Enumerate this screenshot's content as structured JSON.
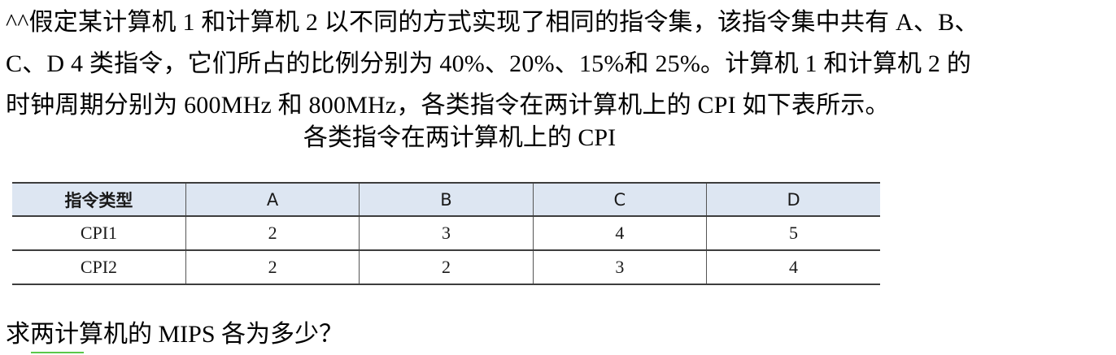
{
  "problem": {
    "lines": [
      "^^假定某计算机 1 和计算机 2 以不同的方式实现了相同的指令集，该指令集中共有 A、B、",
      "C、D 4 类指令，它们所占的比例分别为 40%、20%、15%和 25%。计算机 1 和计算机 2 的",
      "时钟周期分别为 600MHz 和 800MHz，各类指令在两计算机上的 CPI 如下表所示。"
    ],
    "caption": "各类指令在两计算机上的 CPI",
    "question": "求两计算机的 MIPS 各为多少？"
  },
  "table": {
    "headers": [
      "指令类型",
      "A",
      "B",
      "C",
      "D"
    ],
    "rows": [
      [
        "CPI1",
        "2",
        "3",
        "4",
        "5"
      ],
      [
        "CPI2",
        "2",
        "2",
        "3",
        "4"
      ]
    ]
  },
  "colors": {
    "header_bg": "#dde6f2",
    "rule": "#3d3d3d",
    "underline_mark": "#5bc84a"
  }
}
